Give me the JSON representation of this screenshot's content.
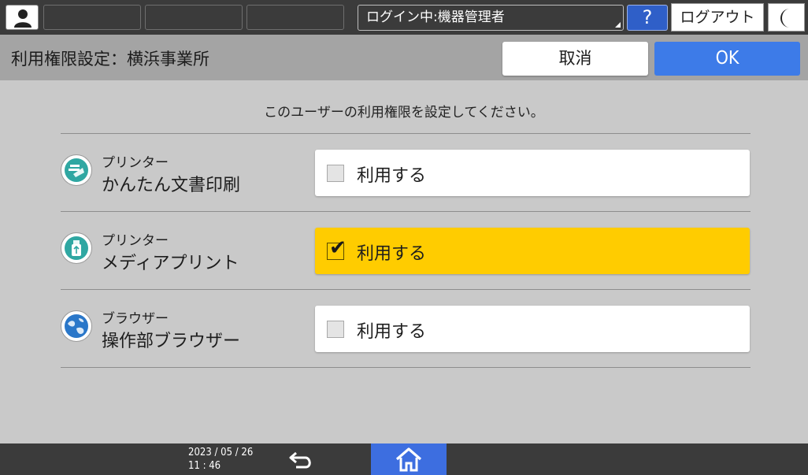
{
  "topbar": {
    "login_status": "ログイン中:機器管理者",
    "help_label": "?",
    "logout_label": "ログアウト"
  },
  "header": {
    "title": "利用権限設定：横浜事業所",
    "cancel_label": "取消",
    "ok_label": "OK"
  },
  "instruction": "このユーザーの利用権限を設定してください。",
  "rows": [
    {
      "category": "プリンター",
      "name": "かんたん文書印刷",
      "option_label": "利用する",
      "checked": false,
      "icon": "document-print-icon"
    },
    {
      "category": "プリンター",
      "name": "メディアプリント",
      "option_label": "利用する",
      "checked": true,
      "icon": "usb-media-icon"
    },
    {
      "category": "ブラウザー",
      "name": "操作部ブラウザー",
      "option_label": "利用する",
      "checked": false,
      "icon": "globe-browser-icon"
    }
  ],
  "footer": {
    "date": "2023 / 05 / 26",
    "time": "11 : 46"
  },
  "colors": {
    "accent_blue": "#3d7be8",
    "checked_yellow": "#ffcc00",
    "bar_dark": "#3b3b3b"
  }
}
